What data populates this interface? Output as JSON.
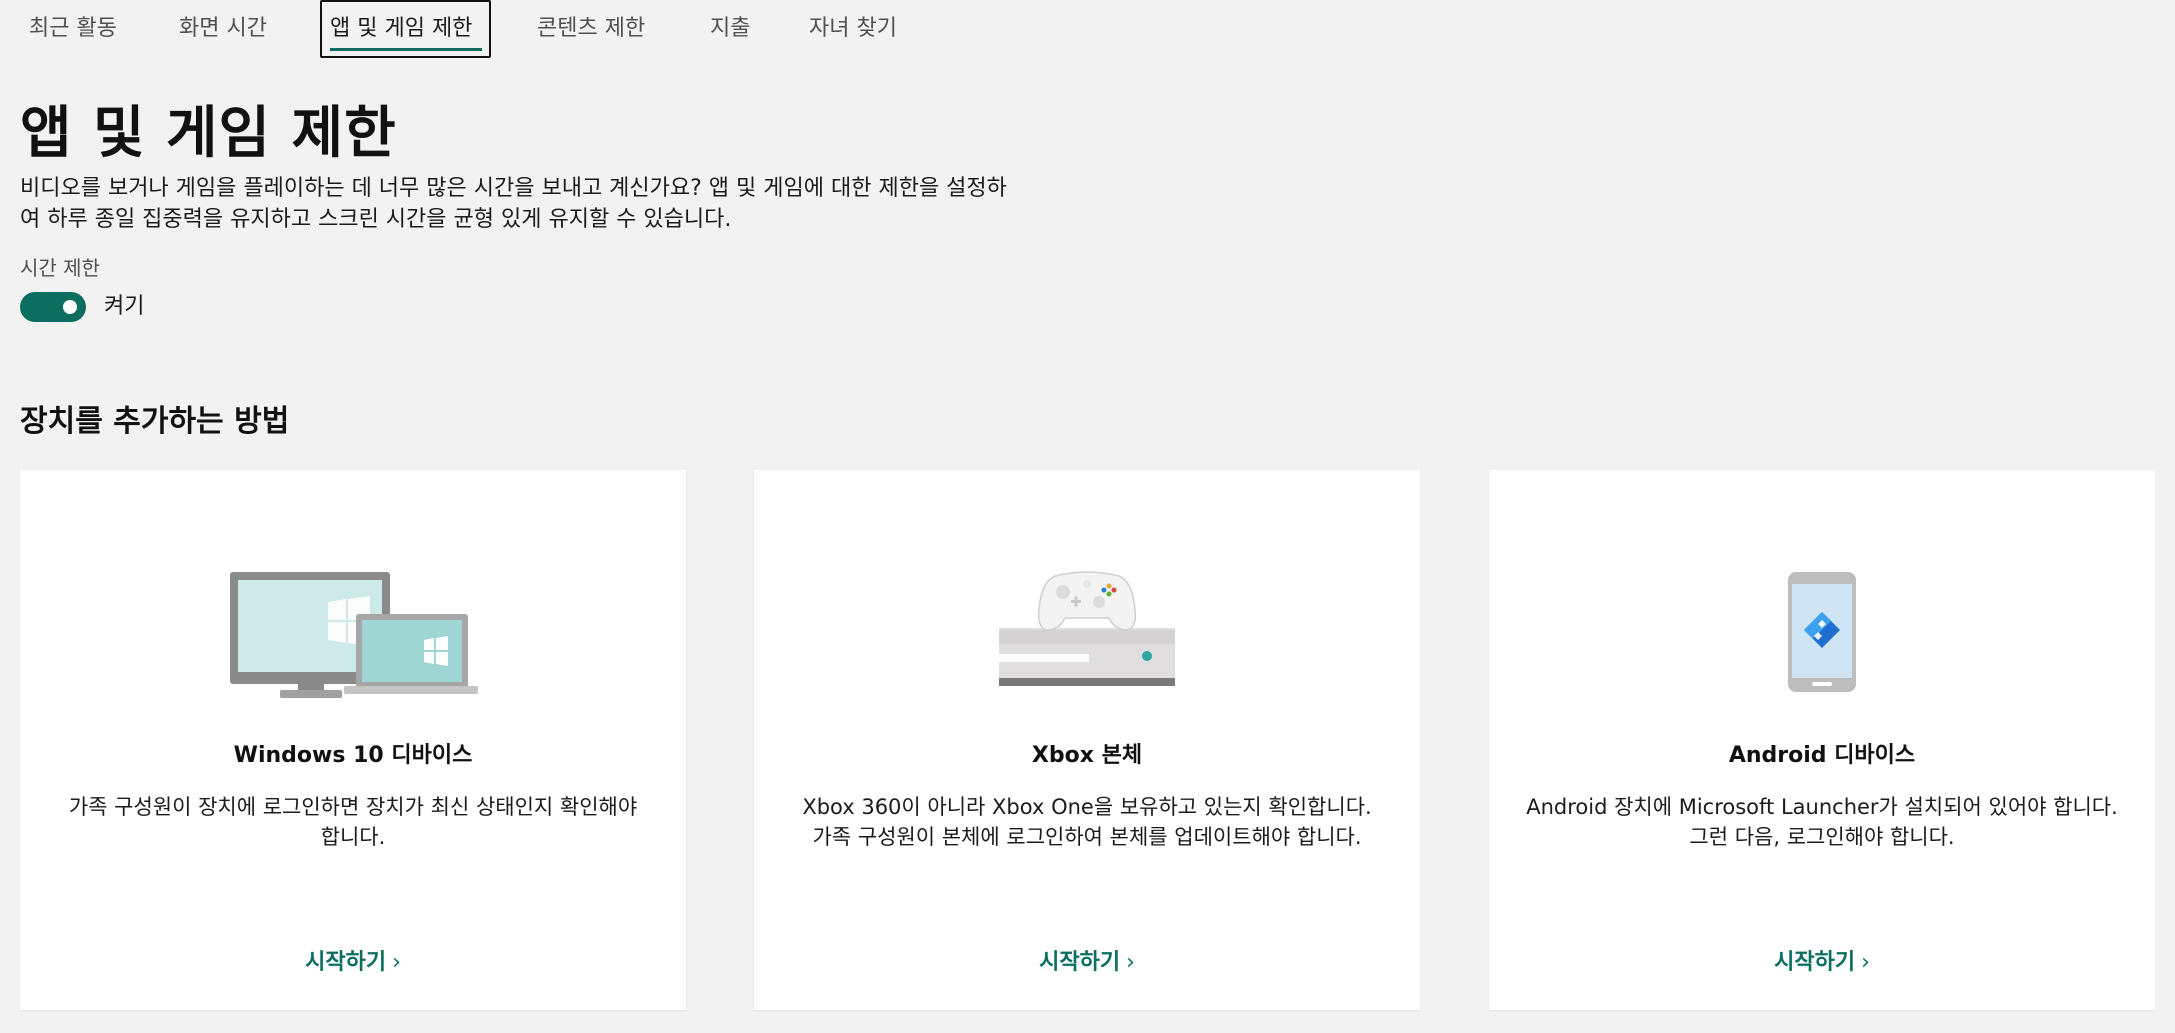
{
  "tabs": [
    {
      "label": "최근 활동"
    },
    {
      "label": "화면 시간"
    },
    {
      "label": "앱 및 게임 제한"
    },
    {
      "label": "콘텐츠 제한"
    },
    {
      "label": "지출"
    },
    {
      "label": "자녀 찾기"
    }
  ],
  "header": {
    "title": "앱 및 게임 제한",
    "description": "비디오를 보거나 게임을 플레이하는 데 너무 많은 시간을 보내고 계신가요? 앱 및 게임에 대한 제한을 설정하여 하루 종일 집중력을 유지하고 스크린 시간을 균형 있게 유지할 수 있습니다.",
    "limit_label": "시간 제한",
    "toggle_state": "켜기"
  },
  "section": {
    "title": "장치를 추가하는 방법"
  },
  "cards": [
    {
      "title": "Windows 10 디바이스",
      "description": "가족 구성원이 장치에 로그인하면 장치가 최신 상태인지 확인해야 합니다.",
      "link": "시작하기"
    },
    {
      "title": "Xbox 본체",
      "description": "Xbox 360이 아니라 Xbox One을 보유하고 있는지 확인합니다. 가족 구성원이 본체에 로그인하여 본체를 업데이트해야 합니다.",
      "link": "시작하기"
    },
    {
      "title": "Android 디바이스",
      "description": "Android 장치에 Microsoft Launcher가 설치되어 있어야 합니다. 그런 다음, 로그인해야 합니다.",
      "link": "시작하기"
    }
  ],
  "colors": {
    "accent": "#0b6e5f",
    "background": "#f2f2f2",
    "card": "#ffffff"
  },
  "icons": [
    "windows-devices-illustration",
    "xbox-console-illustration",
    "android-phone-illustration",
    "chevron-right-icon"
  ]
}
